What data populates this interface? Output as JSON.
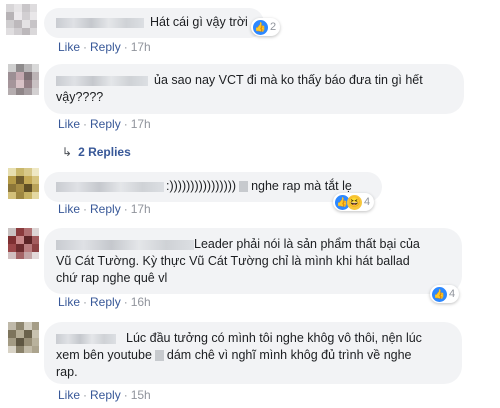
{
  "comments": [
    {
      "text": "Hát cái gì vậy trời",
      "reactions": {
        "count": "2",
        "icons": [
          "like-icon"
        ]
      },
      "actions": {
        "like": "Like",
        "reply": "Reply",
        "time": "17h"
      }
    },
    {
      "text_line1": "ủa sao nay VCT đi mà ko thấy báo đưa tin gì hết",
      "text_line2": "vậy????",
      "actions": {
        "like": "Like",
        "reply": "Reply",
        "time": "17h"
      },
      "replies": {
        "label": "2 Replies"
      }
    },
    {
      "text_prefix": ":))))))))))))))))",
      "text_suffix": "nghe rap mà tắt lẹ",
      "reactions": {
        "count": "4",
        "icons": [
          "haha-icon",
          "like-icon"
        ]
      },
      "actions": {
        "like": "Like",
        "reply": "Reply",
        "time": "17h"
      }
    },
    {
      "text_line1": "Leader phải nói là sản phẩm thất bại của",
      "text_line2": "Vũ Cát Tường. Kỳ thực Vũ Cát Tường chỉ là mình khi hát ballad",
      "text_line3": "chứ rap nghe quê vl",
      "reactions": {
        "count": "4",
        "icons": [
          "like-icon"
        ]
      },
      "actions": {
        "like": "Like",
        "reply": "Reply",
        "time": "16h"
      }
    },
    {
      "text_line1": "Lúc đầu tưởng có mình tôi nghe khôg vô thôi, nện lúc",
      "text_line2a": "xem bên youtube",
      "text_line2b": "dám chê vì nghĩ mình khôg đủ trình về nghe",
      "text_line3": "rap.",
      "actions": {
        "like": "Like",
        "reply": "Reply",
        "time": "15h"
      }
    }
  ],
  "colors": {
    "link": "#385898",
    "muted": "#90949c",
    "bubble": "#f2f3f5",
    "like_blue": "#2d88ff",
    "haha_yellow": "#f7c63c"
  }
}
